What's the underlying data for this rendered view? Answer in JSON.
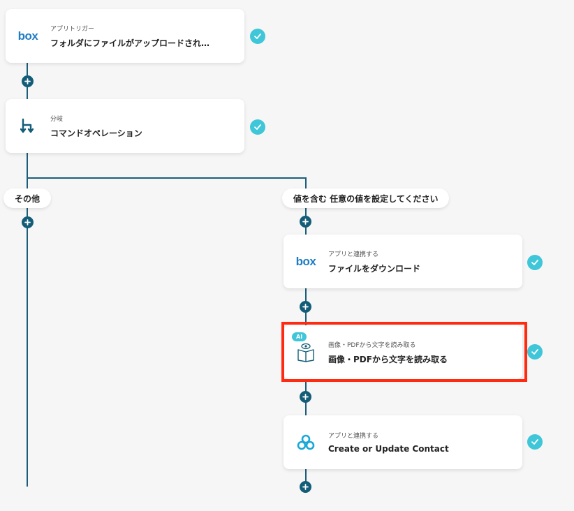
{
  "flow": {
    "steps": [
      {
        "sub": "アプリトリガー",
        "title": "フォルダにファイルがアップロードされ…",
        "icon": "box-icon"
      },
      {
        "sub": "分岐",
        "title": "コマンドオペレーション",
        "icon": "branch-icon"
      },
      {
        "sub": "アプリと連携する",
        "title": "ファイルをダウンロード",
        "icon": "box-icon"
      },
      {
        "sub": "画像・PDFから文字を読み取る",
        "title": "画像・PDFから文字を読み取る",
        "icon": "ocr-book-icon",
        "badge": "AI"
      },
      {
        "sub": "アプリと連携する",
        "title": "Create or Update Contact",
        "icon": "hubspot-icon"
      }
    ],
    "branches": {
      "left": "その他",
      "right": "値を含む 任意の値を設定してください"
    },
    "box_logo_text": "box",
    "selected_step": "画像・PDFから文字を読み取る"
  },
  "colors": {
    "line": "#1b5e7a",
    "check": "#3fc6d8",
    "plus": "#135d78",
    "highlight": "#ff2a10",
    "box_brand": "#1d7cc4"
  }
}
